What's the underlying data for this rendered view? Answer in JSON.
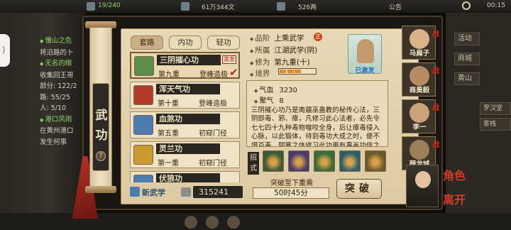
{
  "topbar": {
    "items": [
      "19/240",
      "61万344文",
      "526两",
      "公告",
      "00:15"
    ],
    "colors": {
      "green": "#8fd46a",
      "red": "#e64a3b",
      "text": "#d8cfae"
    }
  },
  "left_tab": {
    "glyph": "⟩"
  },
  "quest_log": {
    "lines": [
      {
        "text": "慢山之危",
        "style": "green-dot"
      },
      {
        "text": "将沿路的卜",
        "style": "white"
      },
      {
        "text": "无名的眼",
        "style": "green-dot"
      },
      {
        "text": "收集回王哥",
        "style": "white"
      },
      {
        "text": "部分: 122/2",
        "style": "white"
      },
      {
        "text": "路: 55/25",
        "style": "white"
      },
      {
        "text": "人: 5/10",
        "style": "white"
      },
      {
        "text": "港口风雨",
        "style": "green-dot"
      },
      {
        "text": "在黄州港口",
        "style": "white"
      },
      {
        "text": "发生何事",
        "style": "white"
      }
    ]
  },
  "right_menu": {
    "buttons": [
      "活动",
      "商城",
      "黄山"
    ],
    "subbuttons": [
      "罗汉堂",
      "客栈"
    ]
  },
  "scroll": {
    "title_1": "武",
    "title_2": "功",
    "help": "?"
  },
  "categories": [
    {
      "label": "套路",
      "active": true
    },
    {
      "label": "内功",
      "active": false
    },
    {
      "label": "轻功",
      "active": false
    }
  ],
  "skills": [
    {
      "name": "三阴摧心功",
      "level": "第九重",
      "stage": "登峰造极",
      "active_badge": "激发",
      "checked": true,
      "selected": true,
      "icon_color": "#5c8f4a"
    },
    {
      "name": "浑天气功",
      "level": "第十重",
      "stage": "登峰造极",
      "active_badge": "",
      "checked": false,
      "selected": false,
      "icon_color": "#b33b2a"
    },
    {
      "name": "血煞功",
      "level": "第五重",
      "stage": "初窥门径",
      "active_badge": "",
      "checked": false,
      "selected": false,
      "icon_color": "#4d7db0"
    },
    {
      "name": "灵兰功",
      "level": "第一重",
      "stage": "初窥门径",
      "active_badge": "",
      "checked": false,
      "selected": false,
      "icon_color": "#c99a2e"
    },
    {
      "name": "伏狼功",
      "level": "",
      "stage": "",
      "active_badge": "",
      "checked": false,
      "selected": false,
      "icon_color": "#4d7db0"
    }
  ],
  "footer": {
    "new_skill": "新武学",
    "points": "315241"
  },
  "detail": {
    "grade_label": "品阶",
    "grade_value": "上乘武学",
    "grade_badge": "正",
    "school_label": "所属",
    "school_value": "江湖武学(阴)",
    "cultivation_label": "修为",
    "cultivation_value": "第九重(十)",
    "realm_label": "境界",
    "realm_level": 0.6,
    "learned_label": "已激发"
  },
  "stats": [
    {
      "label": "气血",
      "value": "3230"
    },
    {
      "label": "聚气",
      "value": "8"
    }
  ],
  "description": "三阴摧心功乃是南疆巫蛊教的秘传心法，三阴即毒、邪、瘴，凡修习此心法者，必先令七七四十九种毒物噬咬全身，后让瘴毒侵入心脉，以此锻体，待到毒功大成之时，便不惧百毒，阴寒之体修习此功更有事半功倍之效。",
  "moves": {
    "label": "招式",
    "icon_colors": [
      "#3f5a36",
      "#4a3a6e",
      "#3c6b3a",
      "#2d5f6a",
      "#6b5a2a"
    ]
  },
  "breakthrough": {
    "hint": "突破至下重需",
    "time": "50时45分",
    "button": "突破"
  },
  "characters": [
    {
      "name": "马扁子",
      "tag": "战",
      "face": "#d9b48a"
    },
    {
      "name": "商昊毅",
      "tag": "战",
      "face": "#b58c63"
    },
    {
      "name": "李一",
      "tag": "战",
      "face": "#c9a27a"
    },
    {
      "name": "薛龙城",
      "tag": "战",
      "face": "#9c7f5a"
    }
  ],
  "side_tabs": [
    "角色",
    "离开"
  ],
  "colors": {
    "accent_red": "#c2261b",
    "parchment": "#e7d9b6",
    "dark_label": "#2b2620",
    "learned_blue": "#1f6fb8"
  }
}
